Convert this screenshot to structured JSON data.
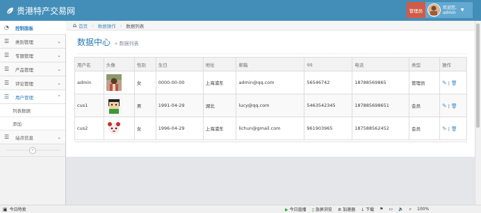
{
  "header": {
    "brand": "贵港特产交易网",
    "role_badge": "管理员",
    "welcome": "欢迎您,",
    "username": "admin"
  },
  "sidebar": {
    "items": [
      {
        "label": "控制面板"
      },
      {
        "label": "类别管理"
      },
      {
        "label": "专题管理"
      },
      {
        "label": "产品管理"
      },
      {
        "label": "评论管理"
      },
      {
        "label": "用户管理"
      },
      {
        "label": "站点信息"
      }
    ],
    "sub_items": [
      {
        "label": "列表数据"
      },
      {
        "label": "添加"
      }
    ]
  },
  "breadcrumbs": {
    "home": "首页",
    "section": "数据操作",
    "current": "数据列表"
  },
  "page_header": {
    "title": "数据中心",
    "subtitle": "» 数据列表"
  },
  "table": {
    "columns": [
      "用户名",
      "头像",
      "性别",
      "生日",
      "地址",
      "邮箱",
      "qq",
      "电话",
      "类型",
      "操作"
    ],
    "rows": [
      {
        "username": "admin",
        "gender": "女",
        "birthday": "0000-00-00",
        "address": "上海浦东",
        "email": "admin@qq.com",
        "qq": "56546742",
        "phone": "18788569865",
        "type": "管理员"
      },
      {
        "username": "cus1",
        "gender": "男",
        "birthday": "1991-04-29",
        "address": "湖北",
        "email": "lucy@qq.com",
        "qq": "5463542345",
        "phone": "187885698651",
        "type": "会员"
      },
      {
        "username": "cus2",
        "gender": "女",
        "birthday": "1996-04-29",
        "address": "上海浦东",
        "email": "lichun@gmail.com",
        "qq": "961903965",
        "phone": "187588562452",
        "type": "会员"
      }
    ],
    "action_sep": "|"
  },
  "statusbar": {
    "left": "今日特卖",
    "live": "今日直播",
    "browser": "急屏浏览",
    "accelerator": "加速器",
    "download": "下载",
    "zoom": "100%"
  },
  "colors": {
    "topbar": "#438eb9",
    "role_badge": "#d15b47",
    "link": "#2679b5"
  }
}
